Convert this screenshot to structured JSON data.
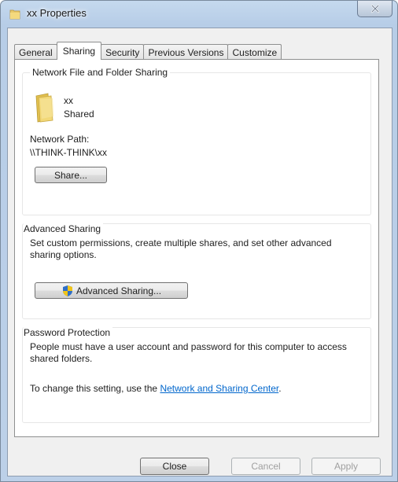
{
  "window": {
    "title": "xx Properties"
  },
  "tabs": [
    {
      "label": "General"
    },
    {
      "label": "Sharing"
    },
    {
      "label": "Security"
    },
    {
      "label": "Previous Versions"
    },
    {
      "label": "Customize"
    }
  ],
  "network_sharing": {
    "group_label": "Network File and Folder Sharing",
    "folder_name": "xx",
    "folder_status": "Shared",
    "path_label": "Network Path:",
    "path_value": "\\\\THINK-THINK\\xx",
    "share_button": "Share..."
  },
  "advanced_sharing": {
    "group_label": "Advanced Sharing",
    "description": "Set custom permissions, create multiple shares, and set other advanced sharing options.",
    "button": "Advanced Sharing..."
  },
  "password_protection": {
    "group_label": "Password Protection",
    "description": "People must have a user account and password for this computer to access shared folders.",
    "change_prefix": "To change this setting, use the ",
    "link": "Network and Sharing Center",
    "change_suffix": "."
  },
  "footer": {
    "close_label": "Close",
    "cancel_label": "Cancel",
    "apply_label": "Apply"
  },
  "icons": {
    "title_icon": "folder-icon",
    "close_icon": "close-x-icon",
    "folder_icon": "folder-icon",
    "shield_icon": "uac-shield-icon"
  }
}
